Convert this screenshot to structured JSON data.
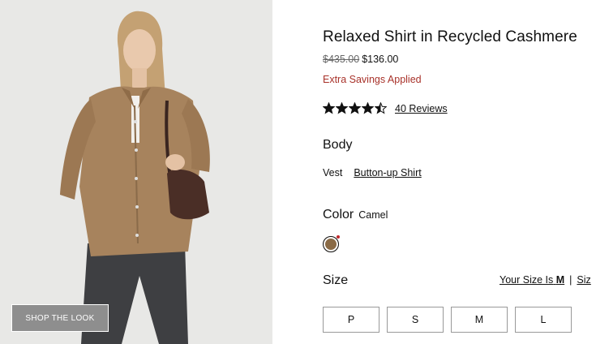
{
  "product": {
    "title": "Relaxed Shirt in Recycled Cashmere",
    "original_price": "$435.00",
    "sale_price": "$136.00",
    "savings_note": "Extra Savings Applied",
    "rating_value": 4.5,
    "rating_max": 5,
    "reviews_link": "40 Reviews"
  },
  "image": {
    "shop_the_look": "SHOP THE LOOK"
  },
  "body": {
    "label": "Body",
    "options": [
      "Vest",
      "Button-up Shirt"
    ],
    "selected": "Button-up Shirt"
  },
  "color": {
    "label": "Color",
    "selected_name": "Camel",
    "swatch_color": "#8a6a45",
    "indicator_color": "#c0282b"
  },
  "size": {
    "label": "Size",
    "your_size_prefix": "Your Size Is",
    "your_size_value": "M",
    "separator": "|",
    "truncated_link": "Siz",
    "options": [
      "P",
      "S",
      "M",
      "L"
    ]
  },
  "colors": {
    "savings_red": "#a8322a",
    "photo_bg": "#e8e8e6",
    "button_gray": "#8e8e8e"
  }
}
